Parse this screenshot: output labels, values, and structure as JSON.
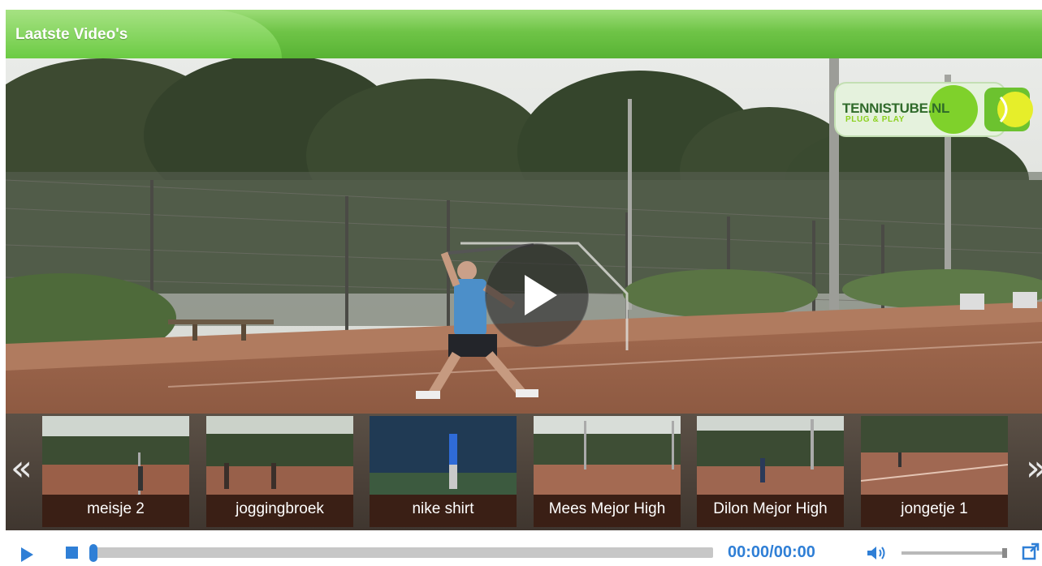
{
  "header": {
    "title": "Laatste Video's"
  },
  "player": {
    "logo": {
      "text": "TENNISTUBE.NL",
      "tagline": "PLUG & PLAY"
    },
    "play_icon": "play-icon"
  },
  "playlist": {
    "prev_arrow": "«",
    "next_arrow": "»",
    "items": [
      {
        "label": "meisje 2"
      },
      {
        "label": "joggingbroek"
      },
      {
        "label": "nike shirt"
      },
      {
        "label": "Mees Mejor High"
      },
      {
        "label": "Dilon Mejor High"
      },
      {
        "label": "jongetje 1"
      }
    ]
  },
  "controls": {
    "time_current": "00:00",
    "time_separator": "/",
    "time_total": "00:00",
    "progress": 0,
    "volume": 1.0
  },
  "colors": {
    "accent": "#2f7fd6",
    "header_green": "#6fc447",
    "strip_bg": "#4a4038"
  }
}
